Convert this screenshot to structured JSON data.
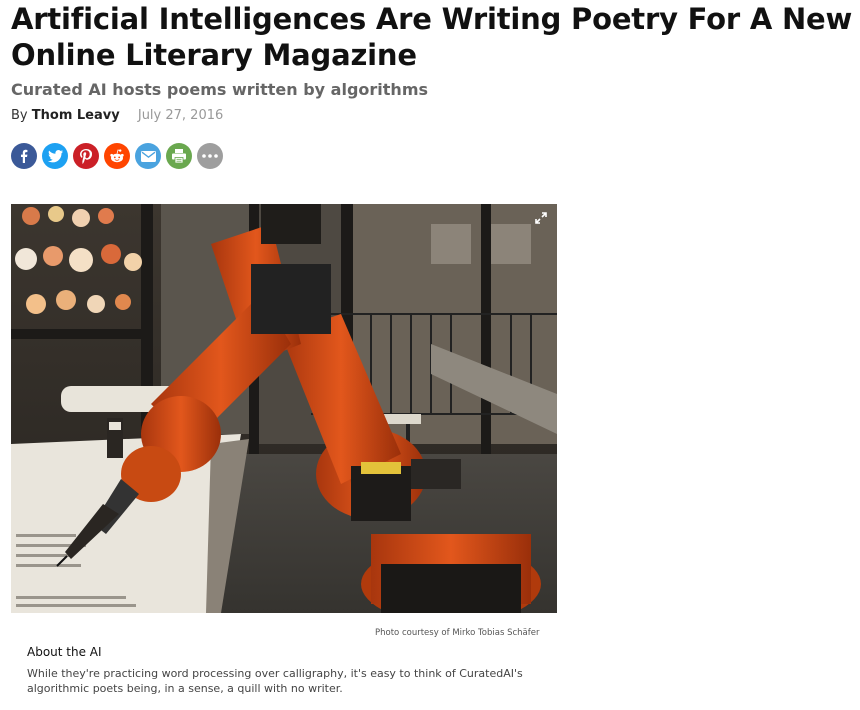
{
  "article": {
    "headline": "Artificial Intelligences Are Writing Poetry For A New Online Literary Magazine",
    "subheadline": "Curated AI hosts poems written by algorithms",
    "byline_prefix": "By",
    "author": "Thom Leavy",
    "date": "July 27, 2016"
  },
  "share_buttons": [
    {
      "name": "facebook",
      "icon": "facebook-icon",
      "color": "#3b5998"
    },
    {
      "name": "twitter",
      "icon": "twitter-icon",
      "color": "#1da1f2"
    },
    {
      "name": "pinterest",
      "icon": "pinterest-icon",
      "color": "#cb2027"
    },
    {
      "name": "reddit",
      "icon": "reddit-icon",
      "color": "#ff4500"
    },
    {
      "name": "email",
      "icon": "email-icon",
      "color": "#4aa3df"
    },
    {
      "name": "print",
      "icon": "print-icon",
      "color": "#6aa84f"
    },
    {
      "name": "more",
      "icon": "more-icon",
      "color": "#9e9e9e"
    }
  ],
  "figure": {
    "image": "orange-industrial-robot-arm-writing-with-quill",
    "expand_icon": "expand-icon",
    "credit": "Photo courtesy of Mirko Tobias Schäfer"
  },
  "caption": {
    "title": "About the AI",
    "text": "While they're practicing word processing over calligraphy, it's easy to think of CuratedAI's algorithmic poets being, in a sense, a quill with no writer."
  }
}
